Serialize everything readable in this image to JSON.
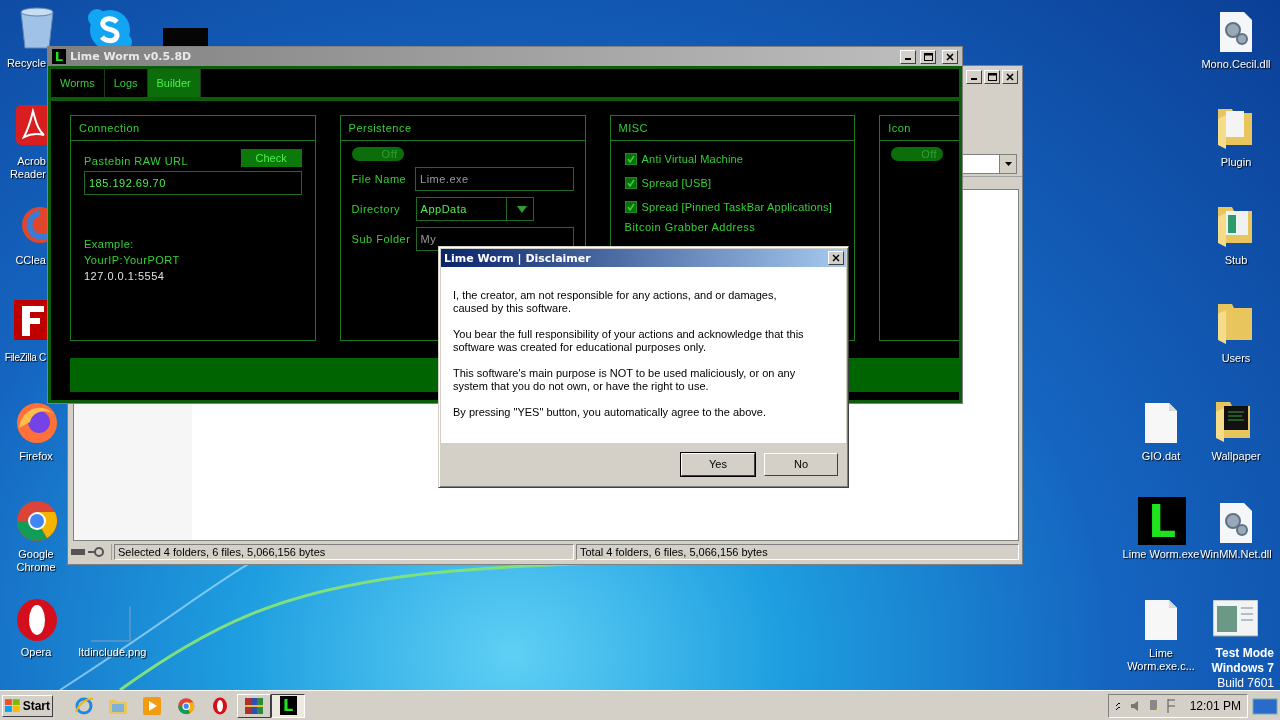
{
  "desktop": {
    "icons_left": [
      {
        "kind": "recycle-bin",
        "label": "Recycle"
      },
      {
        "kind": "skype"
      },
      {
        "kind": "dark-app"
      },
      {
        "kind": "acrobat",
        "label": "Acrob Reader"
      },
      {
        "kind": "ccleaner",
        "label": "CClea"
      },
      {
        "kind": "filezilla",
        "label": "FileZilla C"
      },
      {
        "kind": "firefox",
        "label": "Firefox"
      },
      {
        "kind": "chrome",
        "label": "Google Chrome"
      },
      {
        "kind": "opera",
        "label": "Opera"
      },
      {
        "kind": "blank-image",
        "label": "ltdinclude.png"
      }
    ],
    "icons_right": [
      {
        "kind": "dll",
        "label": "Mono.Cecil.dll"
      },
      {
        "kind": "folder-doc",
        "label": "Plugin"
      },
      {
        "kind": "folder-window",
        "label": "Stub"
      },
      {
        "kind": "folder",
        "label": "Users"
      },
      {
        "kind": "file",
        "label": "GIO.dat"
      },
      {
        "kind": "folder-dark",
        "label": "Wallpaper"
      },
      {
        "kind": "lime-app",
        "letter": "L",
        "label": "Lime Worm.exe"
      },
      {
        "kind": "dll",
        "label": "WinMM.Net.dll"
      },
      {
        "kind": "file",
        "label": "Lime Worm.exe.c..."
      },
      {
        "kind": "window-image"
      }
    ],
    "system_notice": [
      "Test Mode",
      "Windows 7",
      "Build 7601"
    ]
  },
  "explorer": {
    "status_left": "Selected 4 folders, 6 files, 5,066,156 bytes",
    "status_right": "Total 4 folders, 6 files, 5,066,156 bytes"
  },
  "lime_window": {
    "icon_letter": "L",
    "title": "Lime Worm v0.5.8D",
    "tabs": [
      {
        "label": "Worms",
        "selected": false
      },
      {
        "label": "Logs",
        "selected": false
      },
      {
        "label": "Builder",
        "selected": true
      }
    ],
    "connection": {
      "title": "Connection",
      "url_label": "Pastebin RAW URL",
      "check_button": "Check",
      "url_value": "185.192.69.70",
      "example_lines": [
        "Example:",
        "YourIP:YourPORT",
        "127.0.0.1:5554"
      ]
    },
    "persistence": {
      "title": "Persistence",
      "toggle": {
        "on": false,
        "label": "Off"
      },
      "file_name_label": "File Name",
      "file_name": "Lime.exe",
      "directory_label": "Directory",
      "directory": "AppData",
      "sub_folder_label": "Sub Folder",
      "sub_folder": "My"
    },
    "misc": {
      "title": "MISC",
      "options": [
        {
          "label": "Anti Virtual Machine",
          "checked": true
        },
        {
          "label": "Spread [USB]",
          "checked": true
        },
        {
          "label": "Spread [Pinned TaskBar Applications]",
          "checked": true
        }
      ],
      "bitcoin_label": "Bitcoin Grabber Address"
    },
    "icon_panel": {
      "title": "Icon",
      "toggle": {
        "on": false,
        "label": "Off"
      }
    }
  },
  "dialog": {
    "title": "Lime Worm | Disclaimer",
    "paragraphs": [
      "I, the creator, am not responsible for any actions, and or damages, caused by this software.",
      "You bear the full responsibility of your actions and acknowledge that this software was created for educational purposes only.",
      "This software's main purpose is NOT to be used maliciously, or on any system that you do not own, or have the right to use.",
      "By pressing \"YES\" button, you automatically agree to the above."
    ],
    "buttons": [
      {
        "label": "Yes",
        "selected": true
      },
      {
        "label": "No",
        "selected": false
      }
    ]
  },
  "taskbar": {
    "start": "Start",
    "buttons": [
      {
        "kind": "ie",
        "running": false,
        "selected": false
      },
      {
        "kind": "folder",
        "running": false,
        "selected": false
      },
      {
        "kind": "media",
        "running": false,
        "selected": false
      },
      {
        "kind": "chrome",
        "running": false,
        "selected": false
      },
      {
        "kind": "opera",
        "running": false,
        "selected": false
      },
      {
        "kind": "archive",
        "running": true,
        "selected": false
      },
      {
        "kind": "lime",
        "letter": "L",
        "running": true,
        "selected": true
      }
    ],
    "clock": "12:01 PM"
  }
}
